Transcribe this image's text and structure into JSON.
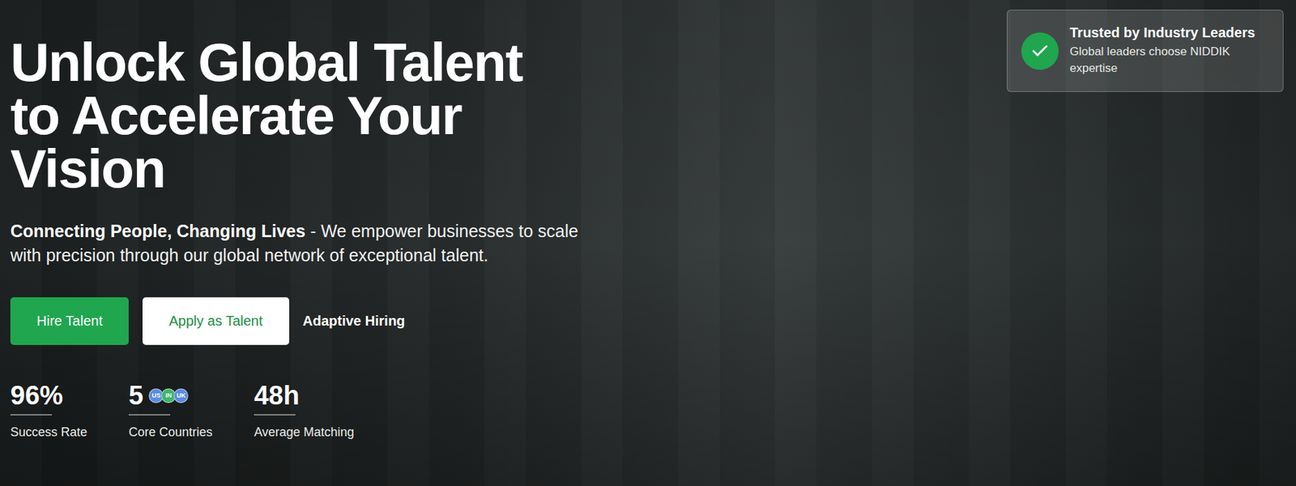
{
  "hero": {
    "title_lines": [
      "Unlock Global Talent",
      "to Accelerate Your",
      "Vision"
    ],
    "tagline": {
      "bold": "Connecting People, Changing Lives",
      "rest": " - We empower businesses to scale with precision through our global network of exceptional talent."
    }
  },
  "buttons": [
    {
      "label": "Hire Talent",
      "kind": "primary"
    },
    {
      "label": "Apply as Talent",
      "kind": "secondary"
    },
    {
      "label": "Adaptive Hiring",
      "kind": "link"
    }
  ],
  "stats": [
    {
      "value": "96%",
      "label": "Success Rate",
      "flags": []
    },
    {
      "value": "5",
      "label": "Core Countries",
      "flags": [
        {
          "code": "US",
          "color": "#5b8de0"
        },
        {
          "code": "IN",
          "color": "#3fb56a"
        },
        {
          "code": "UK",
          "color": "#5b8de0"
        }
      ]
    },
    {
      "value": "48h",
      "label": "Average Matching",
      "flags": []
    }
  ],
  "badge": {
    "title": "Trusted by Industry Leaders",
    "text": "Global leaders choose NIDDIK expertise"
  }
}
